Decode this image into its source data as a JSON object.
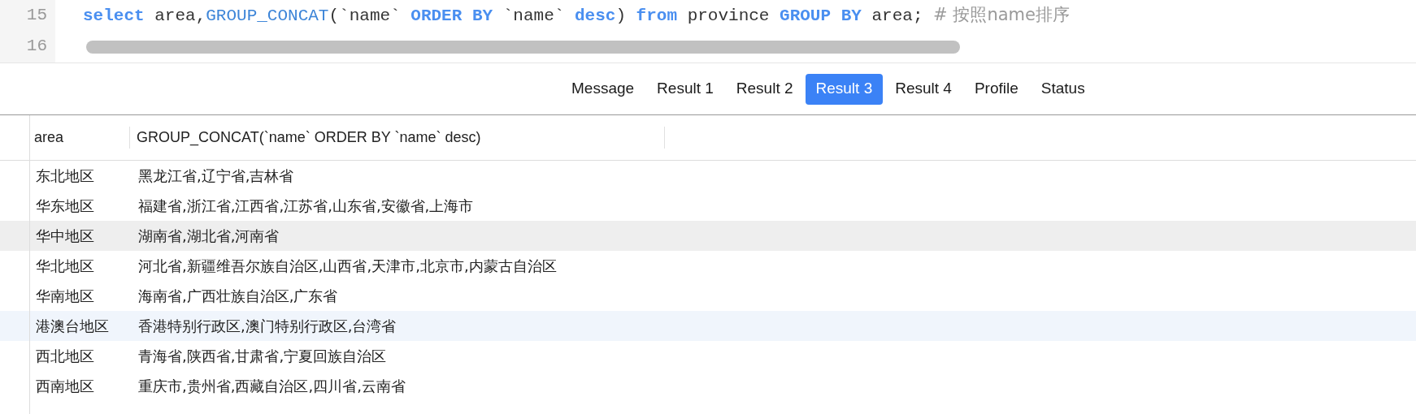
{
  "editor": {
    "lines": [
      {
        "number": "15",
        "tokens": [
          {
            "kind": "keyword",
            "text": "select"
          },
          {
            "kind": "plain",
            "text": " area,"
          },
          {
            "kind": "function",
            "text": "GROUP_CONCAT"
          },
          {
            "kind": "plain",
            "text": "(`name` "
          },
          {
            "kind": "keyword",
            "text": "ORDER BY"
          },
          {
            "kind": "plain",
            "text": " `name` "
          },
          {
            "kind": "keyword",
            "text": "desc"
          },
          {
            "kind": "plain",
            "text": ") "
          },
          {
            "kind": "keyword",
            "text": "from"
          },
          {
            "kind": "plain",
            "text": " province "
          },
          {
            "kind": "keyword",
            "text": "GROUP BY"
          },
          {
            "kind": "plain",
            "text": " area; "
          },
          {
            "kind": "comment",
            "text": "# 按照name排序"
          }
        ]
      },
      {
        "number": "16"
      }
    ]
  },
  "tabs": [
    {
      "label": "Message",
      "selected": false
    },
    {
      "label": "Result 1",
      "selected": false
    },
    {
      "label": "Result 2",
      "selected": false
    },
    {
      "label": "Result 3",
      "selected": true
    },
    {
      "label": "Result 4",
      "selected": false
    },
    {
      "label": "Profile",
      "selected": false
    },
    {
      "label": "Status",
      "selected": false
    }
  ],
  "table": {
    "columns": [
      "area",
      "GROUP_CONCAT(`name` ORDER BY `name` desc)"
    ],
    "rows": [
      {
        "cells": [
          "东北地区",
          "黑龙江省,辽宁省,吉林省"
        ],
        "shaded": false,
        "selected": false
      },
      {
        "cells": [
          "华东地区",
          "福建省,浙江省,江西省,江苏省,山东省,安徽省,上海市"
        ],
        "shaded": false,
        "selected": false
      },
      {
        "cells": [
          "华中地区",
          "湖南省,湖北省,河南省"
        ],
        "shaded": true,
        "selected": false
      },
      {
        "cells": [
          "华北地区",
          "河北省,新疆维吾尔族自治区,山西省,天津市,北京市,内蒙古自治区"
        ],
        "shaded": false,
        "selected": false
      },
      {
        "cells": [
          "华南地区",
          "海南省,广西壮族自治区,广东省"
        ],
        "shaded": false,
        "selected": false
      },
      {
        "cells": [
          "港澳台地区",
          "香港特别行政区,澳门特别行政区,台湾省"
        ],
        "shaded": false,
        "selected": true
      },
      {
        "cells": [
          "西北地区",
          "青海省,陕西省,甘肃省,宁夏回族自治区"
        ],
        "shaded": false,
        "selected": false
      },
      {
        "cells": [
          "西南地区",
          "重庆市,贵州省,西藏自治区,四川省,云南省"
        ],
        "shaded": false,
        "selected": false
      }
    ]
  }
}
